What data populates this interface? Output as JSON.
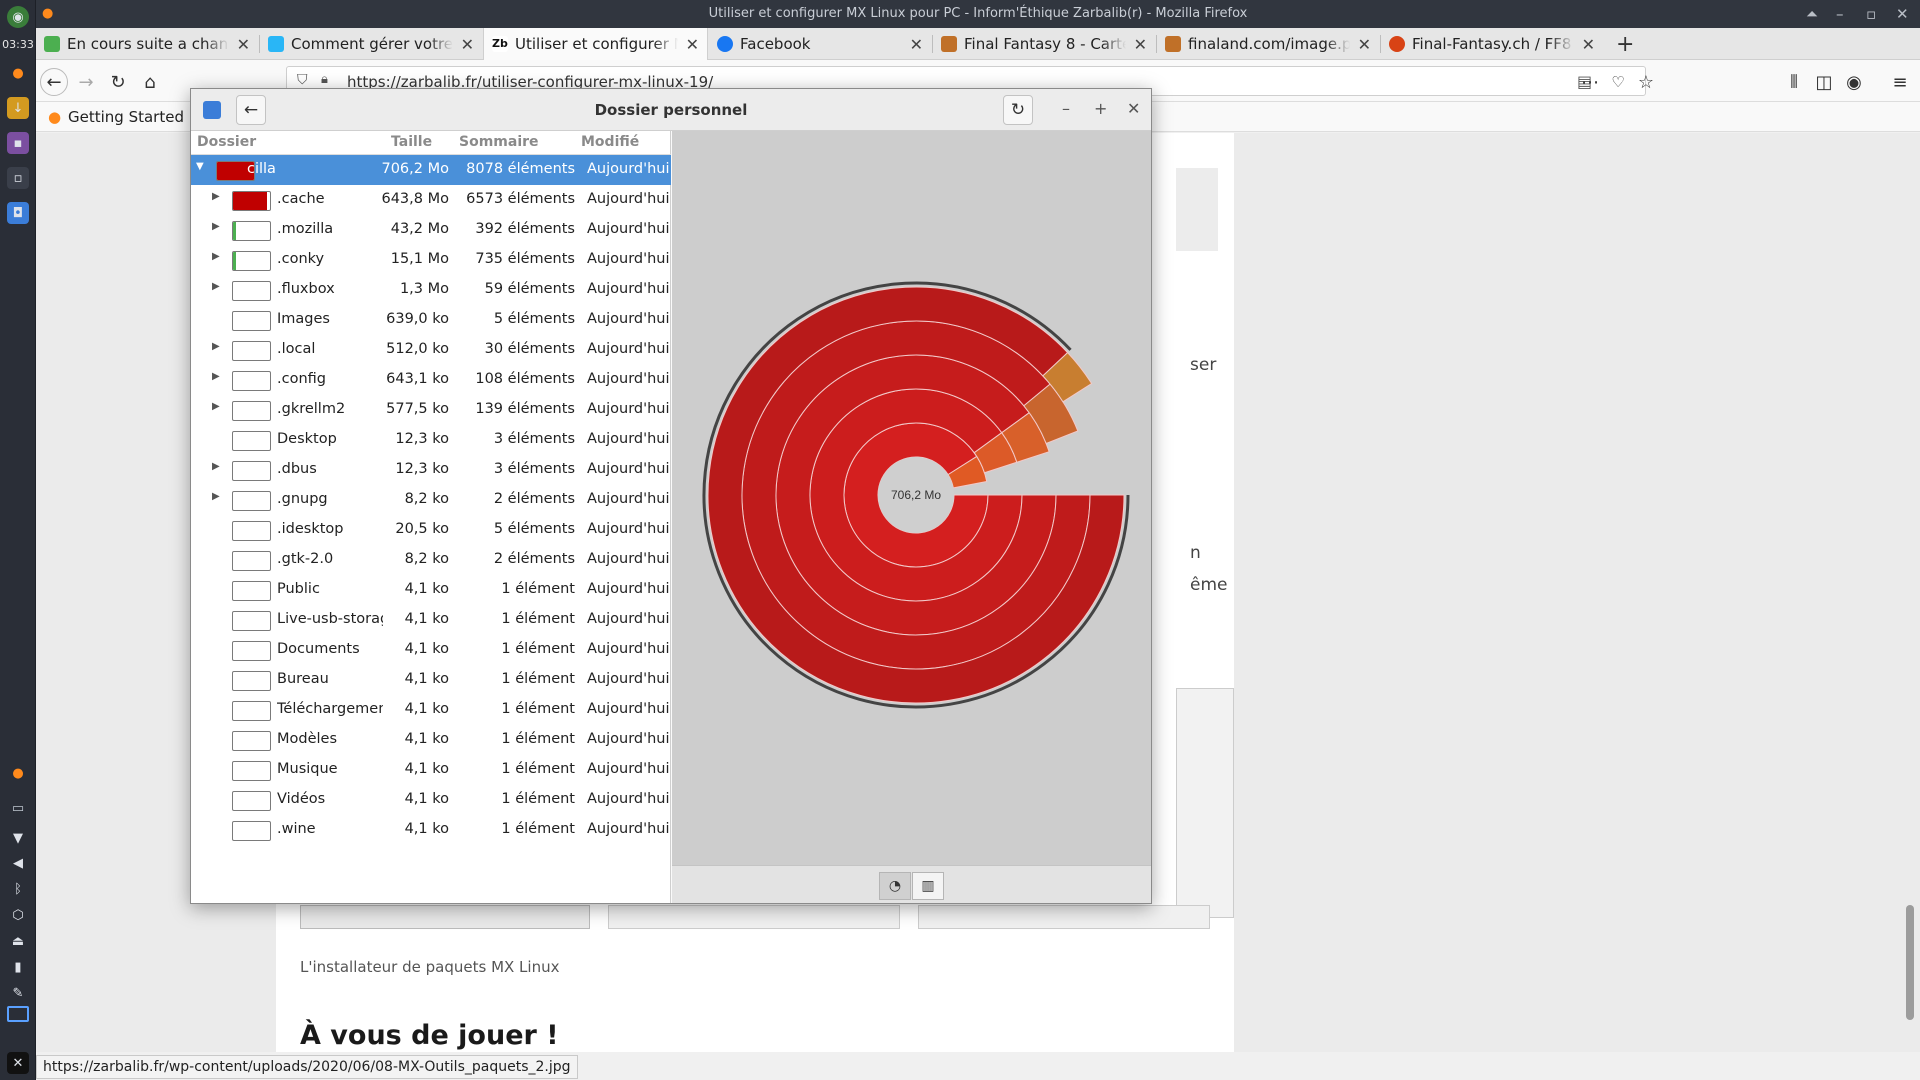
{
  "dock": {
    "clock": "03:33",
    "icons": [
      "mx-logo-icon",
      "firefox-icon",
      "download-icon",
      "terminal-icon",
      "desktop-icon",
      "baobab-icon",
      "firefox-small-icon",
      "files-icon",
      "network-icon",
      "volume-icon",
      "bluetooth-icon",
      "package-icon",
      "eject-icon",
      "battery-icon",
      "clip-icon",
      "workspace-icon",
      "xfce-icon"
    ]
  },
  "window_title": "Utiliser et configurer MX Linux pour PC - Inform'Éthique Zarbalib(r) - Mozilla Firefox",
  "tabs": [
    {
      "label": "En cours suite a changer",
      "icon": "chat-icon",
      "color": "#4caf50"
    },
    {
      "label": "Comment gérer votre dis",
      "icon": "support-icon",
      "color": "#29b6f6"
    },
    {
      "label": "Utiliser et configurer MX",
      "icon": "zarbalib-icon",
      "color": "#222222"
    },
    {
      "label": "Facebook",
      "icon": "facebook-icon",
      "color": "#1877f2"
    },
    {
      "label": "Final Fantasy 8 - Cartes -",
      "icon": "finalfantasy-icon",
      "color": "#c07028"
    },
    {
      "label": "finaland.com/image.php",
      "icon": "finaland-icon",
      "color": "#c07028"
    },
    {
      "label": "Final-Fantasy.ch / FF8 / q",
      "icon": "ffch-icon",
      "color": "#d84315"
    }
  ],
  "url": "https://zarbalib.fr/utiliser-configurer-mx-linux-19/",
  "bookmark": "Getting Started",
  "page": {
    "fragments": [
      "ser",
      "n",
      "ême"
    ],
    "caption": "L'installateur de paquets MX Linux",
    "heading": "À vous de jouer !",
    "status_url": "https://zarbalib.fr/wp-content/uploads/2020/06/08-MX-Outils_paquets_2.jpg"
  },
  "baobab": {
    "title": "Dossier personnel",
    "columns": [
      "Dossier",
      "Taille",
      "Sommaire",
      "Modifié"
    ],
    "root": {
      "name": "cilla",
      "size": "706,2 Mo",
      "count": "8078 éléments",
      "modified": "Aujourd'hui",
      "fill": 1.0
    },
    "rows": [
      {
        "name": ".cache",
        "size": "643,8 Mo",
        "count": "6573 éléments",
        "modified": "Aujourd'hui",
        "fill": 0.91,
        "expandable": true
      },
      {
        "name": ".mozilla",
        "size": "43,2 Mo",
        "count": "392 éléments",
        "modified": "Aujourd'hui",
        "fill": 0.06,
        "expandable": true
      },
      {
        "name": ".conky",
        "size": "15,1 Mo",
        "count": "735 éléments",
        "modified": "Aujourd'hui",
        "fill": 0.02,
        "expandable": true
      },
      {
        "name": ".fluxbox",
        "size": "1,3 Mo",
        "count": "59 éléments",
        "modified": "Aujourd'hui",
        "fill": 0,
        "expandable": true
      },
      {
        "name": "Images",
        "size": "639,0 ko",
        "count": "5 éléments",
        "modified": "Aujourd'hui",
        "fill": 0,
        "expandable": false
      },
      {
        "name": ".local",
        "size": "512,0 ko",
        "count": "30 éléments",
        "modified": "Aujourd'hui",
        "fill": 0,
        "expandable": true
      },
      {
        "name": ".config",
        "size": "643,1 ko",
        "count": "108 éléments",
        "modified": "Aujourd'hui",
        "fill": 0,
        "expandable": true
      },
      {
        "name": ".gkrellm2",
        "size": "577,5 ko",
        "count": "139 éléments",
        "modified": "Aujourd'hui",
        "fill": 0,
        "expandable": true
      },
      {
        "name": "Desktop",
        "size": "12,3 ko",
        "count": "3 éléments",
        "modified": "Aujourd'hui",
        "fill": 0,
        "expandable": false
      },
      {
        "name": ".dbus",
        "size": "12,3 ko",
        "count": "3 éléments",
        "modified": "Aujourd'hui",
        "fill": 0,
        "expandable": true
      },
      {
        "name": ".gnupg",
        "size": "8,2 ko",
        "count": "2 éléments",
        "modified": "Aujourd'hui",
        "fill": 0,
        "expandable": true
      },
      {
        "name": ".idesktop",
        "size": "20,5 ko",
        "count": "5 éléments",
        "modified": "Aujourd'hui",
        "fill": 0,
        "expandable": false
      },
      {
        "name": ".gtk-2.0",
        "size": "8,2 ko",
        "count": "2 éléments",
        "modified": "Aujourd'hui",
        "fill": 0,
        "expandable": false
      },
      {
        "name": "Public",
        "size": "4,1 ko",
        "count": "1 élément",
        "modified": "Aujourd'hui",
        "fill": 0,
        "expandable": false
      },
      {
        "name": "Live-usb-storag",
        "size": "4,1 ko",
        "count": "1 élément",
        "modified": "Aujourd'hui",
        "fill": 0,
        "expandable": false
      },
      {
        "name": "Documents",
        "size": "4,1 ko",
        "count": "1 élément",
        "modified": "Aujourd'hui",
        "fill": 0,
        "expandable": false
      },
      {
        "name": "Bureau",
        "size": "4,1 ko",
        "count": "1 élément",
        "modified": "Aujourd'hui",
        "fill": 0,
        "expandable": false
      },
      {
        "name": "Téléchargemen",
        "size": "4,1 ko",
        "count": "1 élément",
        "modified": "Aujourd'hui",
        "fill": 0,
        "expandable": false
      },
      {
        "name": "Modèles",
        "size": "4,1 ko",
        "count": "1 élément",
        "modified": "Aujourd'hui",
        "fill": 0,
        "expandable": false
      },
      {
        "name": "Musique",
        "size": "4,1 ko",
        "count": "1 élément",
        "modified": "Aujourd'hui",
        "fill": 0,
        "expandable": false
      },
      {
        "name": "Vidéos",
        "size": "4,1 ko",
        "count": "1 élément",
        "modified": "Aujourd'hui",
        "fill": 0,
        "expandable": false
      },
      {
        "name": ".wine",
        "size": "4,1 ko",
        "count": "1 élément",
        "modified": "Aujourd'hui",
        "fill": 0,
        "expandable": false
      }
    ],
    "ring_chart": {
      "center_label": "706,2 Mo",
      "fill_color": "#c00000",
      "rings": [
        {
          "level": 1,
          "segments": [
            {
              "name": ".cache",
              "fraction": 0.91,
              "color": "#d41f1f"
            },
            {
              "name": ".mozilla",
              "fraction": 0.06,
              "color": "#e05a24"
            }
          ]
        },
        {
          "level": 2,
          "segments": [
            {
              "fraction": 0.9,
              "color": "#cc1d1d"
            },
            {
              "fraction": 0.05,
              "color": "#dc5a28"
            }
          ]
        },
        {
          "level": 3,
          "segments": [
            {
              "fraction": 0.9,
              "color": "#c61c1c"
            },
            {
              "fraction": 0.05,
              "color": "#d8602a"
            }
          ]
        },
        {
          "level": 4,
          "segments": [
            {
              "fraction": 0.89,
              "color": "#bf1b1b"
            },
            {
              "fraction": 0.05,
              "color": "#c8652e"
            }
          ]
        },
        {
          "level": 5,
          "segments": [
            {
              "fraction": 0.88,
              "color": "#b81a1a"
            },
            {
              "fraction": 0.03,
              "color": "#c87e30"
            }
          ]
        }
      ]
    }
  }
}
